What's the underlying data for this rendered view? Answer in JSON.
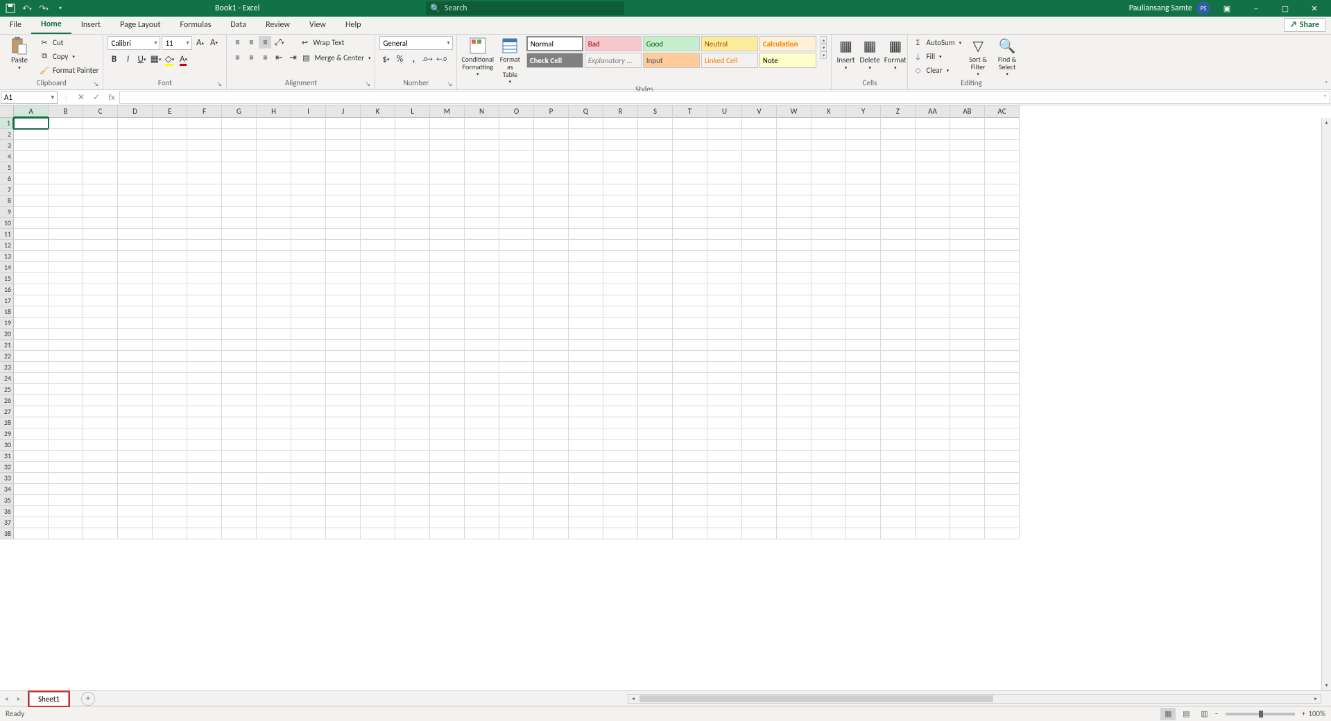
{
  "titlebar": {
    "doc_title": "Book1  -  Excel",
    "search_placeholder": "Search",
    "user_name": "Pauliansang Samte",
    "user_initials": "PS"
  },
  "tabs": {
    "file": "File",
    "home": "Home",
    "insert": "Insert",
    "page_layout": "Page Layout",
    "formulas": "Formulas",
    "data": "Data",
    "review": "Review",
    "view": "View",
    "help": "Help",
    "share": "Share"
  },
  "ribbon": {
    "clipboard": {
      "label": "Clipboard",
      "paste": "Paste",
      "cut": "Cut",
      "copy": "Copy",
      "format_painter": "Format Painter"
    },
    "font": {
      "label": "Font",
      "name": "Calibri",
      "size": "11"
    },
    "alignment": {
      "label": "Alignment",
      "wrap": "Wrap Text",
      "merge": "Merge & Center"
    },
    "number": {
      "label": "Number",
      "format": "General"
    },
    "styles": {
      "label": "Styles",
      "cond": "Conditional\nFormatting",
      "fat": "Format as\nTable",
      "normal": "Normal",
      "bad": "Bad",
      "good": "Good",
      "neutral": "Neutral",
      "calc": "Calculation",
      "check": "Check Cell",
      "explan": "Explanatory ...",
      "input": "Input",
      "linked": "Linked Cell",
      "note": "Note"
    },
    "cells": {
      "label": "Cells",
      "insert": "Insert",
      "delete": "Delete",
      "format": "Format"
    },
    "editing": {
      "label": "Editing",
      "autosum": "AutoSum",
      "fill": "Fill",
      "clear": "Clear",
      "sort": "Sort &\nFilter",
      "find": "Find &\nSelect"
    }
  },
  "namebox": {
    "value": "A1"
  },
  "columns": [
    "A",
    "B",
    "C",
    "D",
    "E",
    "F",
    "G",
    "H",
    "I",
    "J",
    "K",
    "L",
    "M",
    "N",
    "O",
    "P",
    "Q",
    "R",
    "S",
    "T",
    "U",
    "V",
    "W",
    "X",
    "Y",
    "Z",
    "AA",
    "AB",
    "AC"
  ],
  "rows_count": 38,
  "sheet": {
    "name": "Sheet1"
  },
  "status": {
    "ready": "Ready",
    "zoom": "100%"
  },
  "colors": {
    "accent": "#127245",
    "bad_bg": "#f6c8ce",
    "bad_fg": "#9c0006",
    "good_bg": "#c6efce",
    "good_fg": "#006100",
    "neutral_bg": "#ffeb9c",
    "neutral_fg": "#9c5700",
    "calc_bg": "#fff1d8",
    "calc_fg": "#fa7d00",
    "check_bg": "#808080",
    "check_fg": "#ffffff",
    "input_bg": "#ffcc99",
    "input_fg": "#3f3f76",
    "linked_fg": "#fa7d00",
    "note_bg": "#ffffcc"
  }
}
